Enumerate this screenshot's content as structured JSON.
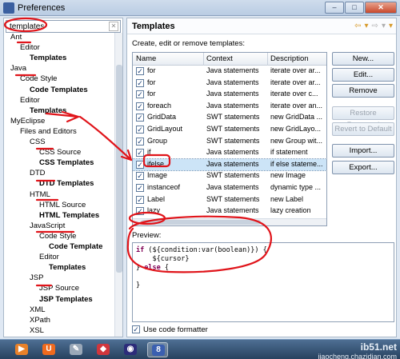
{
  "window": {
    "title": "Preferences",
    "minimize": "–",
    "maximize": "□",
    "close": "✕"
  },
  "filter": {
    "value": "templates"
  },
  "tree": [
    {
      "label": "Ant",
      "bold": false,
      "indent": 0
    },
    {
      "label": "Editor",
      "bold": false,
      "indent": 1
    },
    {
      "label": "Templates",
      "bold": true,
      "indent": 2
    },
    {
      "label": "Java",
      "bold": false,
      "indent": 0
    },
    {
      "label": "Code Style",
      "bold": false,
      "indent": 1
    },
    {
      "label": "Code Templates",
      "bold": true,
      "indent": 2
    },
    {
      "label": "Editor",
      "bold": false,
      "indent": 1
    },
    {
      "label": "Templates",
      "bold": true,
      "indent": 2
    },
    {
      "label": "MyEclipse",
      "bold": false,
      "indent": 0
    },
    {
      "label": "Files and Editors",
      "bold": false,
      "indent": 1
    },
    {
      "label": "CSS",
      "bold": false,
      "indent": 2
    },
    {
      "label": "CSS Source",
      "bold": false,
      "indent": 3
    },
    {
      "label": "CSS Templates",
      "bold": true,
      "indent": 3
    },
    {
      "label": "DTD",
      "bold": false,
      "indent": 2
    },
    {
      "label": "DTD Templates",
      "bold": true,
      "indent": 3
    },
    {
      "label": "HTML",
      "bold": false,
      "indent": 2
    },
    {
      "label": "HTML Source",
      "bold": false,
      "indent": 3
    },
    {
      "label": "HTML Templates",
      "bold": true,
      "indent": 3
    },
    {
      "label": "JavaScript",
      "bold": false,
      "indent": 2
    },
    {
      "label": "Code Style",
      "bold": false,
      "indent": 3
    },
    {
      "label": "Code Template",
      "bold": true,
      "indent": 4
    },
    {
      "label": "Editor",
      "bold": false,
      "indent": 3
    },
    {
      "label": "Templates",
      "bold": true,
      "indent": 4
    },
    {
      "label": "JSP",
      "bold": false,
      "indent": 2
    },
    {
      "label": "JSP Source",
      "bold": false,
      "indent": 3
    },
    {
      "label": "JSP Templates",
      "bold": true,
      "indent": 3
    },
    {
      "label": "XML",
      "bold": false,
      "indent": 2
    },
    {
      "label": "XPath",
      "bold": false,
      "indent": 2
    },
    {
      "label": "XSL",
      "bold": false,
      "indent": 2
    }
  ],
  "panel": {
    "title": "Templates",
    "description": "Create, edit or remove templates:",
    "nav_back": "⇦",
    "nav_back_menu": "▾",
    "nav_fwd": "⇨",
    "nav_fwd_menu": "▾",
    "nav_more": "▾"
  },
  "table": {
    "columns": [
      "Name",
      "Context",
      "Description"
    ],
    "rows": [
      {
        "name": "for",
        "context": "Java statements",
        "description": "iterate over ar...",
        "checked": true,
        "selected": false
      },
      {
        "name": "for",
        "context": "Java statements",
        "description": "iterate over ar...",
        "checked": true,
        "selected": false
      },
      {
        "name": "for",
        "context": "Java statements",
        "description": "iterate over c...",
        "checked": true,
        "selected": false
      },
      {
        "name": "foreach",
        "context": "Java statements",
        "description": "iterate over an...",
        "checked": true,
        "selected": false
      },
      {
        "name": "GridData",
        "context": "SWT statements",
        "description": "new GridData ...",
        "checked": true,
        "selected": false
      },
      {
        "name": "GridLayout",
        "context": "SWT statements",
        "description": "new GridLayo...",
        "checked": true,
        "selected": false
      },
      {
        "name": "Group",
        "context": "SWT statements",
        "description": "new Group wit...",
        "checked": true,
        "selected": false
      },
      {
        "name": "if",
        "context": "Java statements",
        "description": "if statement",
        "checked": true,
        "selected": false
      },
      {
        "name": "ifelse",
        "context": "Java statements",
        "description": "if else stateme...",
        "checked": true,
        "selected": true
      },
      {
        "name": "Image",
        "context": "SWT statements",
        "description": "new Image",
        "checked": true,
        "selected": false
      },
      {
        "name": "instanceof",
        "context": "Java statements",
        "description": "dynamic type ...",
        "checked": true,
        "selected": false
      },
      {
        "name": "Label",
        "context": "SWT statements",
        "description": "new Label",
        "checked": true,
        "selected": false
      },
      {
        "name": "lazy",
        "context": "Java statements",
        "description": "lazy creation",
        "checked": true,
        "selected": false
      }
    ]
  },
  "buttons": {
    "new": "New...",
    "edit": "Edit...",
    "remove": "Remove",
    "restore_removed": "Restore Removed",
    "revert_default": "Revert to Default",
    "import": "Import...",
    "export": "Export..."
  },
  "preview": {
    "label": "Preview:",
    "line1_kw": "if",
    "line1_rest": " (${condition:var(boolean)}) {",
    "line2": "    ${cursor}",
    "line3_pre": "} ",
    "line3_kw": "else",
    "line3_post": " {",
    "line4": "",
    "line5": "}"
  },
  "use_code_formatter": {
    "label": "Use code formatter",
    "checked": true
  },
  "taskbar": {
    "items": [
      {
        "icon": "media-player-icon",
        "glyph": "▶",
        "color": "#e8812a",
        "active": false
      },
      {
        "icon": "uc-browser-icon",
        "glyph": "U",
        "color": "#f06a1e",
        "active": false
      },
      {
        "icon": "paint-tool-icon",
        "glyph": "✎",
        "color": "#9aa8b8",
        "active": false
      },
      {
        "icon": "app-stack-icon",
        "glyph": "◆",
        "color": "#d0363d",
        "active": false
      },
      {
        "icon": "eclipse-icon",
        "glyph": "◉",
        "color": "#2c2c7a",
        "active": false
      },
      {
        "icon": "myeclipse-icon",
        "glyph": "8",
        "color": "#3b5fb0",
        "active": true
      }
    ]
  },
  "watermark": {
    "line1": "ib51.net",
    "line2": "jiaocheng.chazidian.com"
  },
  "colors": {
    "annotation": "#e0141a",
    "selection": "#cce4f7",
    "taskbar": "#2f4b6c"
  }
}
